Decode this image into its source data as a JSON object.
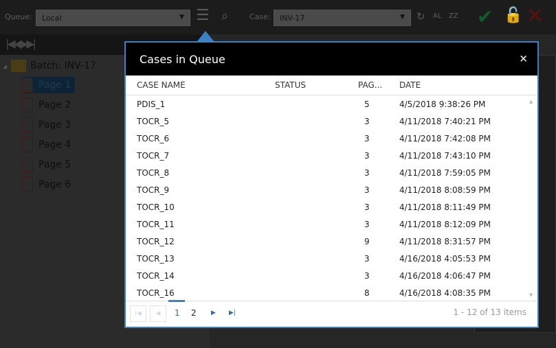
{
  "toolbar": {
    "queue_label": "Queue:",
    "queue_value": "Local",
    "case_label": "Case:",
    "case_value": "INV-17",
    "al": "AL",
    "zz": "ZZ"
  },
  "tree": {
    "batch": "Batch: INV-17",
    "pages": [
      "Page 1",
      "Page 2",
      "Page 3",
      "Page 4",
      "Page 5",
      "Page 6"
    ]
  },
  "dialog": {
    "title": "Cases in Queue",
    "close": "×",
    "columns": [
      "CASE NAME",
      "STATUS",
      "PAG...",
      "DATE"
    ],
    "rows": [
      {
        "name": "PDIS_1",
        "status": "",
        "pages": "5",
        "date": "4/5/2018 9:38:26 PM"
      },
      {
        "name": "TOCR_5",
        "status": "",
        "pages": "3",
        "date": "4/11/2018 7:40:21 PM"
      },
      {
        "name": "TOCR_6",
        "status": "",
        "pages": "3",
        "date": "4/11/2018 7:42:08 PM"
      },
      {
        "name": "TOCR_7",
        "status": "",
        "pages": "3",
        "date": "4/11/2018 7:43:10 PM"
      },
      {
        "name": "TOCR_8",
        "status": "",
        "pages": "3",
        "date": "4/11/2018 7:59:05 PM"
      },
      {
        "name": "TOCR_9",
        "status": "",
        "pages": "3",
        "date": "4/11/2018 8:08:59 PM"
      },
      {
        "name": "TOCR_10",
        "status": "",
        "pages": "3",
        "date": "4/11/2018 8:11:49 PM"
      },
      {
        "name": "TOCR_11",
        "status": "",
        "pages": "3",
        "date": "4/11/2018 8:12:09 PM"
      },
      {
        "name": "TOCR_12",
        "status": "",
        "pages": "9",
        "date": "4/11/2018 8:31:57 PM"
      },
      {
        "name": "TOCR_13",
        "status": "",
        "pages": "3",
        "date": "4/16/2018 4:05:53 PM"
      },
      {
        "name": "TOCR_14",
        "status": "",
        "pages": "3",
        "date": "4/16/2018 4:06:47 PM"
      },
      {
        "name": "TOCR_16",
        "status": "",
        "pages": "8",
        "date": "4/16/2018 4:08:35 PM"
      }
    ],
    "pager": {
      "pages": [
        "1",
        "2"
      ],
      "current": "1",
      "info": "1 - 12 of 13 items"
    }
  },
  "colors": {
    "accent": "#3a82c4",
    "check": "#0f5e2a",
    "lock": "#6b5a00",
    "x": "#5e1010"
  }
}
